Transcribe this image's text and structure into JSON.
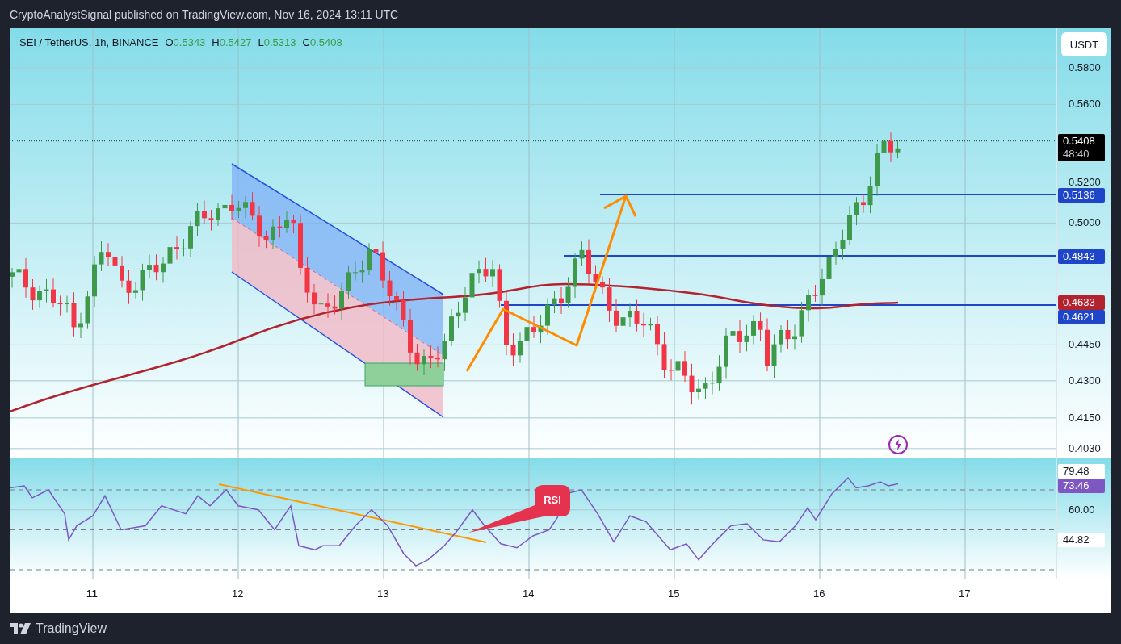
{
  "header": {
    "publisher": "CryptoAnalystSignal published on TradingView.com, Nov 16, 2024 13:11 UTC"
  },
  "legend": {
    "symbol": "SEI / TetherUS, 1h, BINANCE",
    "ohlc": [
      {
        "key": "O",
        "value": "0.5343"
      },
      {
        "key": "H",
        "value": "0.5427"
      },
      {
        "key": "L",
        "value": "0.5313"
      },
      {
        "key": "C",
        "value": "0.5408"
      }
    ]
  },
  "price_axis": {
    "currency": "USDT",
    "ticks": [
      "0.5800",
      "0.5600",
      "0.5200",
      "0.5000",
      "0.4450",
      "0.4300",
      "0.4150",
      "0.4030"
    ],
    "markers": [
      {
        "kind": "last",
        "value": "0.5408",
        "countdown": "48:40"
      },
      {
        "kind": "level",
        "value": "0.5136"
      },
      {
        "kind": "level",
        "value": "0.4843"
      },
      {
        "kind": "average",
        "value": "0.4633"
      },
      {
        "kind": "level",
        "value": "0.4621"
      }
    ]
  },
  "rsi": {
    "callout": "RSI",
    "ticks": [
      "60.00"
    ],
    "markers": [
      {
        "kind": "band",
        "value": "79.48"
      },
      {
        "kind": "current",
        "value": "73.46"
      },
      {
        "kind": "band",
        "value": "44.82"
      }
    ]
  },
  "time_axis": [
    {
      "label": "11",
      "bold": true
    },
    {
      "label": "12",
      "bold": false
    },
    {
      "label": "13",
      "bold": false
    },
    {
      "label": "14",
      "bold": false
    },
    {
      "label": "15",
      "bold": false
    },
    {
      "label": "16",
      "bold": false
    },
    {
      "label": "17",
      "bold": false
    }
  ],
  "footer": {
    "brand": "TradingView"
  }
}
